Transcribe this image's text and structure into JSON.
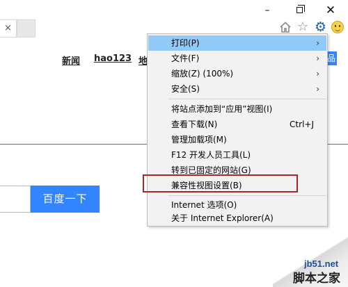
{
  "window_controls": {
    "minimize": "–",
    "close": "✕"
  },
  "tab": {
    "close_label": "×"
  },
  "toolbar": {
    "star": "☆",
    "gear": "⚙"
  },
  "nav": {
    "news": "新闻",
    "hao123": "hao123",
    "map": "地",
    "more": "品"
  },
  "search": {
    "button_label": "百度一下",
    "placeholder": ""
  },
  "tools_menu": {
    "print": "打印(P)",
    "file": "文件(F)",
    "zoom": "缩放(Z) (100%)",
    "safety": "安全(S)",
    "add_to_apps": "将站点添加到“应用”视图(I)",
    "view_downloads": "查看下载(N)",
    "view_downloads_shortcut": "Ctrl+J",
    "manage_addons": "管理加载项(M)",
    "dev_tools": "F12 开发人员工具(L)",
    "pinned_sites": "转到已固定的网站(G)",
    "compat_view": "兼容性视图设置(B)",
    "internet_options": "Internet 选项(O)",
    "about_ie": "关于 Internet Explorer(A)",
    "submenu_arrow": "›"
  },
  "watermark": {
    "site": "jb51.net",
    "name": "脚本之家"
  },
  "colors": {
    "accent": "#3385ff",
    "menu_highlight": "#91c9f7",
    "annotation_red": "#a8262b",
    "red_line": "#e23b3b"
  }
}
